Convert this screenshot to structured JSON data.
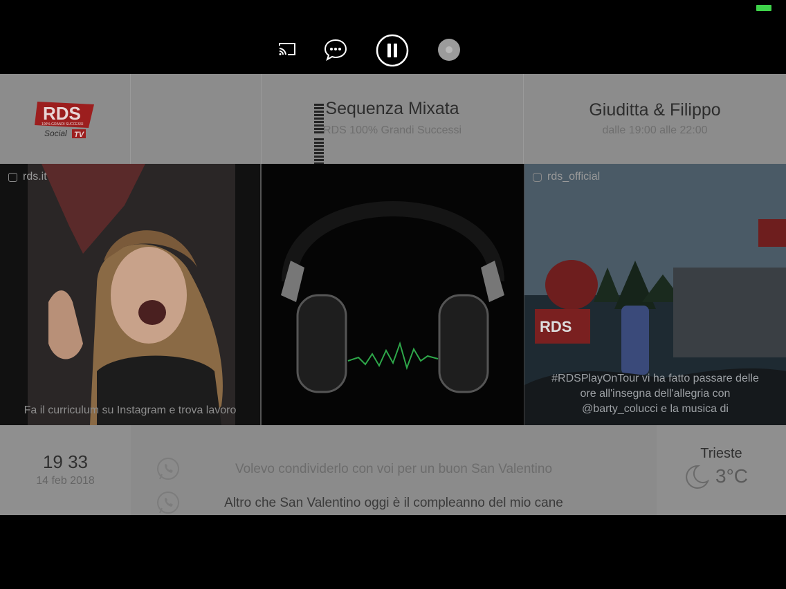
{
  "status": {
    "battery_color": "#3ed24a"
  },
  "controls": {
    "cast_icon": "cast-icon",
    "chat_icon": "chat-bubble-icon",
    "pause_icon": "pause-icon",
    "avatar_icon": "user-avatar"
  },
  "header": {
    "logo_main": "RDS",
    "logo_tagline": "100% GRANDI SUCCESSI",
    "logo_social": "Social",
    "logo_tv": "TV",
    "now_playing_title": "Sequenza Mixata",
    "now_playing_subtitle": "RDS 100% Grandi Successi",
    "host_title": "Giuditta & Filippo",
    "host_schedule": "dalle 19:00 alle 22:00"
  },
  "tiles": [
    {
      "source": "rds.it",
      "source_icon": "news-icon",
      "caption": "Fa il curriculum su Instagram e trova lavoro"
    },
    {
      "source": "",
      "caption": ""
    },
    {
      "source": "rds_official",
      "source_icon": "instagram-icon",
      "caption_lines": [
        "#RDSPlayOnTour vi ha fatto passare delle",
        "ore all'insegna dell'allegria con",
        "@barty_colucci e la musica di"
      ]
    }
  ],
  "clock": {
    "time": "19 33",
    "date": "14 feb 2018"
  },
  "messages": [
    {
      "icon": "whatsapp-icon",
      "text": "Volevo condividerlo con voi per un buon San Valentino"
    },
    {
      "icon": "whatsapp-icon",
      "text": "Altro che San Valentino oggi è il compleanno del mio cane"
    }
  ],
  "weather": {
    "city": "Trieste",
    "temperature": "3°C",
    "icon": "moon-icon"
  }
}
